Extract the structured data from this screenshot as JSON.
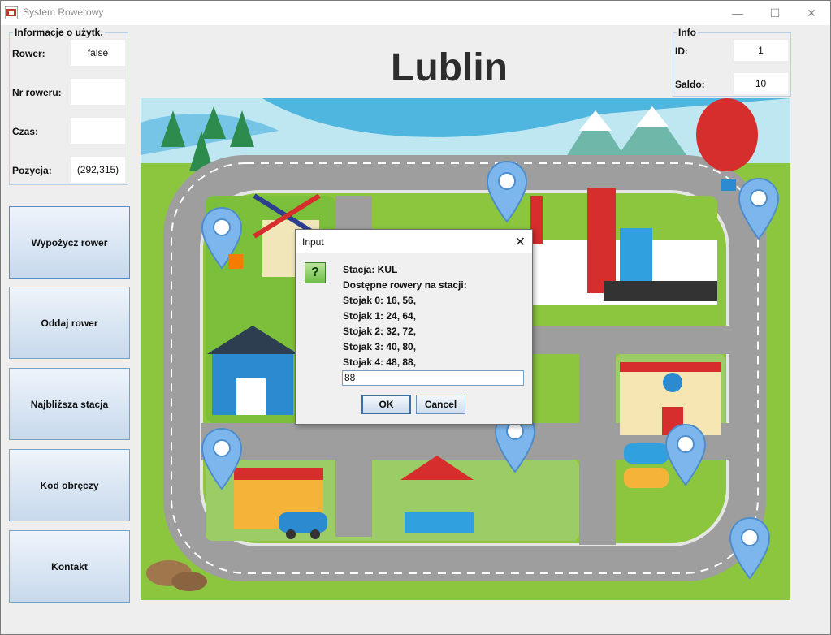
{
  "window": {
    "title": "System Rowerowy",
    "controls": {
      "minimize": "—",
      "maximize": "☐",
      "close": "✕"
    }
  },
  "user_info": {
    "legend": "Informacje o użytk.",
    "rows": [
      {
        "label": "Rower:",
        "value": "false"
      },
      {
        "label": "Nr roweru:",
        "value": ""
      },
      {
        "label": "Czas:",
        "value": ""
      },
      {
        "label": "Pozycja:",
        "value": "(292,315)"
      }
    ]
  },
  "info": {
    "legend": "Info",
    "id_label": "ID:",
    "id_value": "1",
    "saldo_label": "Saldo:",
    "saldo_value": "10"
  },
  "sidebar": {
    "buttons": [
      {
        "label": "Wypożycz rower"
      },
      {
        "label": "Oddaj rower"
      },
      {
        "label": "Najbliższa stacja"
      },
      {
        "label": "Kod obręczy"
      },
      {
        "label": "Kontakt"
      }
    ]
  },
  "city_title": "Lublin",
  "map": {
    "stations": 8
  },
  "dialog": {
    "title": "Input",
    "close": "✕",
    "icon": "?",
    "lines": [
      "Stacja: KUL",
      "Dostępne rowery na stacji:",
      "Stojak 0: 16, 56,",
      "Stojak 1: 24, 64,",
      "Stojak 2: 32, 72,",
      "Stojak 3: 40, 80,",
      "Stojak 4: 48, 88,"
    ],
    "input_value": "88",
    "ok_label": "OK",
    "cancel_label": "Cancel"
  },
  "colors": {
    "accent": "#5c8bc0",
    "map_grass": "#8cc63f",
    "road": "#9a9a9a",
    "pin": "#7db6ec"
  }
}
